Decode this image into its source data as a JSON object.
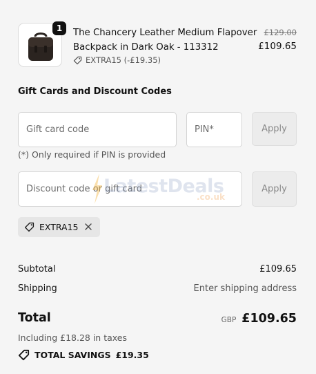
{
  "product": {
    "quantity": "1",
    "name": "The Chancery Leather Medium Flapover Backpack in Dark Oak - 113312",
    "discount_label": "EXTRA15 (-£19.35)",
    "original_price": "£129.00",
    "price": "£109.65",
    "image_icon": "backpack-icon"
  },
  "discount_section": {
    "title": "Gift Cards and Discount Codes",
    "gift_card_placeholder": "Gift card code",
    "pin_placeholder": "PIN*",
    "apply_label": "Apply",
    "pin_hint": "(*) Only required if PIN is provided",
    "discount_placeholder": "Discount code or gift card",
    "applied_code": "EXTRA15"
  },
  "watermark": {
    "text": "LatestDeals",
    "suffix": ".co.uk"
  },
  "summary": {
    "subtotal_label": "Subtotal",
    "subtotal_value": "£109.65",
    "shipping_label": "Shipping",
    "shipping_value": "Enter shipping address",
    "total_label": "Total",
    "currency": "GBP",
    "total_value": "£109.65",
    "tax_note": "Including £18.28 in taxes",
    "savings_label": "TOTAL SAVINGS",
    "savings_value": "£19.35"
  },
  "colors": {
    "page_bg": "#f5f5f5",
    "badge_bg": "#111111",
    "tag_bg": "#e6e6e6"
  }
}
